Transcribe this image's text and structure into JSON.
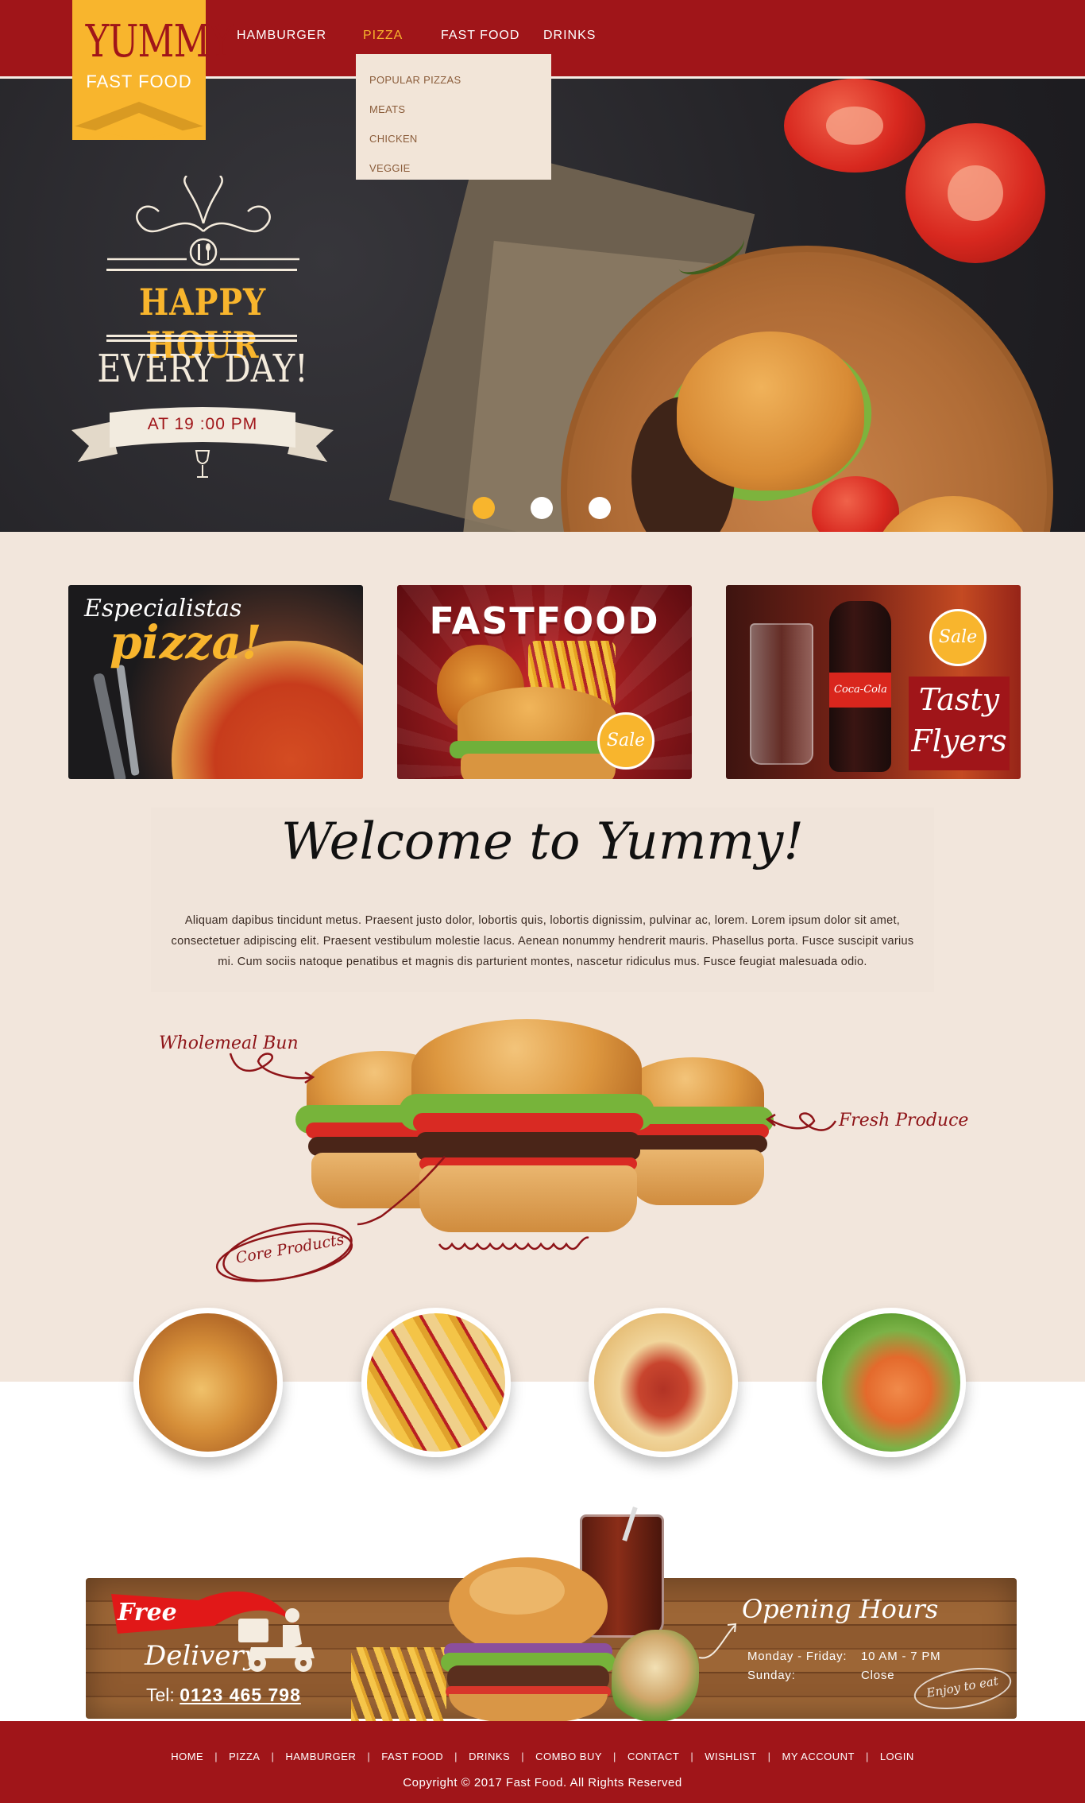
{
  "logo": {
    "main": "YUMMY",
    "sub": "FAST FOOD"
  },
  "nav": {
    "items": [
      {
        "label": "HAMBURGER"
      },
      {
        "label": "PIZZA"
      },
      {
        "label": "FAST FOOD"
      },
      {
        "label": "DRINKS"
      }
    ],
    "active": "PIZZA",
    "dropdown": [
      "POPULAR PIZZAS",
      "MEATS",
      "CHICKEN",
      "VEGGIE"
    ]
  },
  "hero": {
    "title": "HAPPY HOUR",
    "subtitle": "EVERY DAY!",
    "time": "AT 19 :00 PM",
    "slides_count": 3,
    "active_slide": 1
  },
  "promos": [
    {
      "line1": "Especialistas",
      "line2": "pizza!"
    },
    {
      "title": "FASTFOOD",
      "badge": "Sale"
    },
    {
      "badge": "Sale",
      "line1": "Tasty",
      "line2": "Flyers",
      "bottle_label": "Coca-Cola"
    }
  ],
  "welcome": {
    "title": "Welcome to Yummy!",
    "body": "Aliquam dapibus tincidunt metus. Praesent justo dolor, lobortis quis, lobortis dignissim, pulvinar ac, lorem. Lorem ipsum dolor sit amet, consectetuer adipiscing elit. Praesent vestibulum molestie lacus. Aenean nonummy hendrerit mauris. Phasellus porta. Fusce suscipit varius mi. Cum sociis natoque penatibus et magnis dis parturient montes, nascetur ridiculus mus. Fusce feugiat malesuada odio."
  },
  "annotations": {
    "bun": "Wholemeal Bun",
    "produce": "Fresh Produce",
    "core": "Core Products"
  },
  "thumbs": [
    {
      "icon": "pastry-thumb"
    },
    {
      "icon": "fries-thumb"
    },
    {
      "icon": "hotdog-thumb"
    },
    {
      "icon": "shrimp-salad-thumb"
    }
  ],
  "delivery": {
    "free": "Free",
    "label": "Delivery",
    "tel_prefix": "Tel: ",
    "tel": "0123 465 798",
    "hours_title": "Opening Hours",
    "hours": [
      {
        "day": "Monday - Friday:",
        "time": "10 AM - 7 PM"
      },
      {
        "day": "Sunday:",
        "time": "Close"
      }
    ],
    "stamp": "Enjoy to eat"
  },
  "footer": {
    "links": [
      "HOME",
      "PIZZA",
      "HAMBURGER",
      "FAST FOOD",
      "DRINKS",
      "COMBO BUY",
      "CONTACT",
      "WISHLIST",
      "MY ACCOUNT",
      "LOGIN"
    ],
    "copyright": "Copyright © 2017 Fast Food. All Rights Reserved"
  },
  "colors": {
    "brand_red": "#a01519",
    "accent_yellow": "#f8b52d",
    "cream": "#f2e6dc"
  }
}
